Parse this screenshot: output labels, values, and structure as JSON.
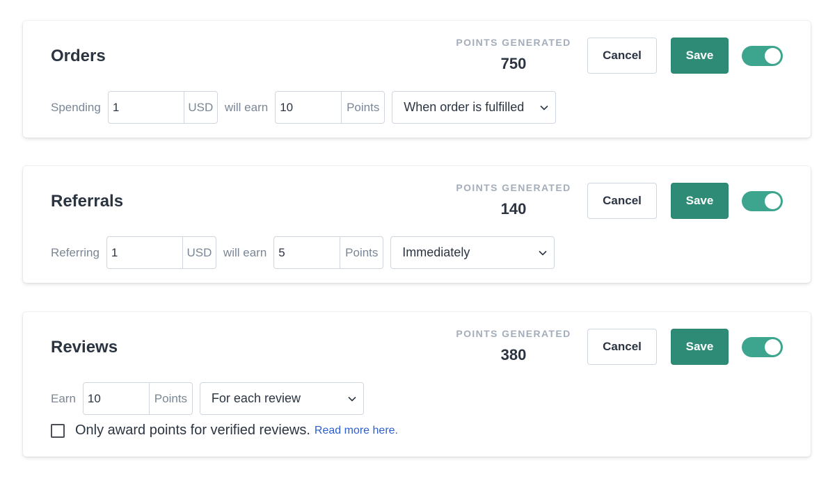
{
  "orders": {
    "title": "Orders",
    "points_label": "POINTS GENERATED",
    "points_value": "750",
    "cancel_label": "Cancel",
    "save_label": "Save",
    "toggle_on": true,
    "spend_label": "Spending",
    "spend_value": "1",
    "spend_unit": "USD",
    "earn_label": "will earn",
    "earn_value": "10",
    "earn_unit": "Points",
    "trigger": "When order is fulfilled"
  },
  "referrals": {
    "title": "Referrals",
    "points_label": "POINTS GENERATED",
    "points_value": "140",
    "cancel_label": "Cancel",
    "save_label": "Save",
    "toggle_on": true,
    "spend_label": "Referring",
    "spend_value": "1",
    "spend_unit": "USD",
    "earn_label": "will earn",
    "earn_value": "5",
    "earn_unit": "Points",
    "trigger": "Immediately"
  },
  "reviews": {
    "title": "Reviews",
    "points_label": "POINTS GENERATED",
    "points_value": "380",
    "cancel_label": "Cancel",
    "save_label": "Save",
    "toggle_on": true,
    "earn_label": "Earn",
    "earn_value": "10",
    "earn_unit": "Points",
    "trigger": "For each review",
    "verified_checked": false,
    "verified_label": "Only award points for verified reviews.",
    "read_more": "Read more here."
  },
  "colors": {
    "accent": "#2e8b76",
    "toggle": "#3da58d",
    "link": "#2b5fcf"
  },
  "icons": {
    "select_arrow": "chevron-down-icon"
  }
}
